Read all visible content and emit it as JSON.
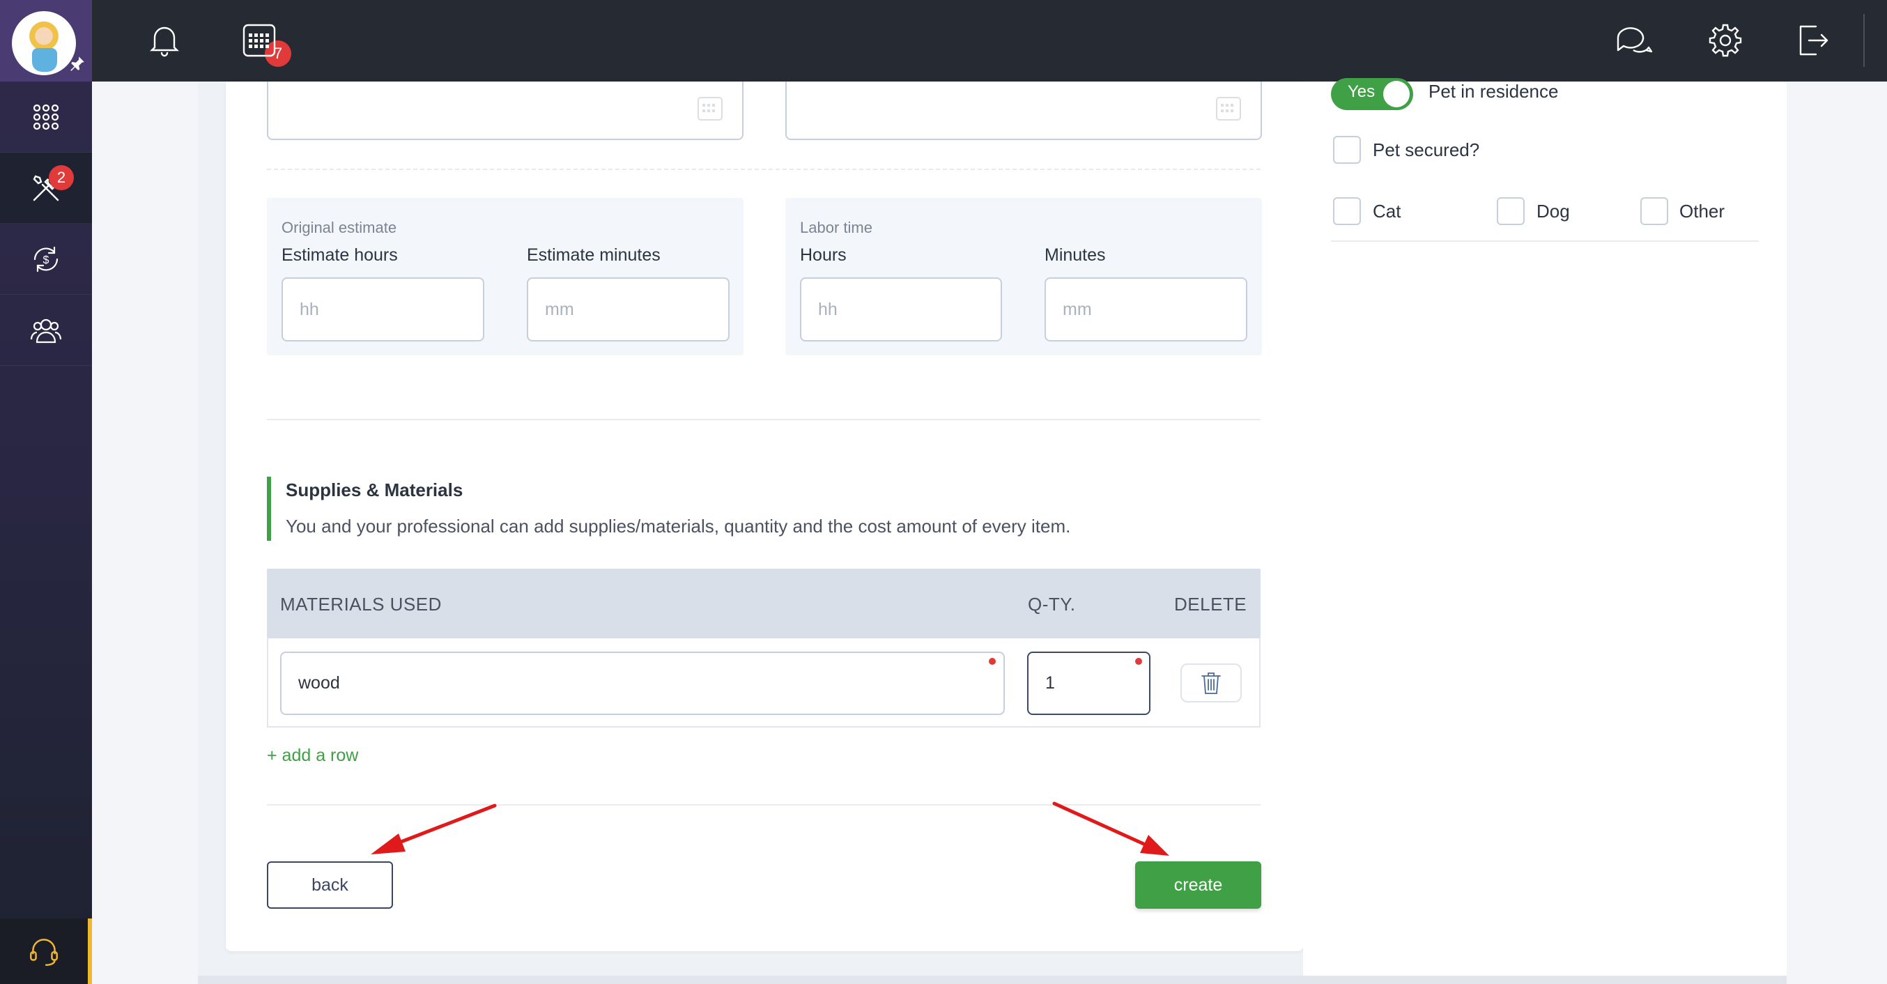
{
  "topbar": {
    "notification_count": "7"
  },
  "sidebar": {
    "tools_badge": "2"
  },
  "time": {
    "original_estimate": {
      "caption": "Original estimate",
      "hours_label": "Estimate hours",
      "hours_placeholder": "hh",
      "minutes_label": "Estimate minutes",
      "minutes_placeholder": "mm"
    },
    "labor_time": {
      "caption": "Labor time",
      "hours_label": "Hours",
      "hours_placeholder": "hh",
      "minutes_label": "Minutes",
      "minutes_placeholder": "mm"
    }
  },
  "supplies": {
    "title": "Supplies & Materials",
    "description": "You and your professional can add supplies/materials, quantity and the cost amount of every item.",
    "columns": [
      "MATERIALS USED",
      "Q-TY.",
      "DELETE"
    ],
    "rows": [
      {
        "material": "wood",
        "quantity": "1"
      }
    ],
    "add_row_label": "+ add a row"
  },
  "actions": {
    "back_label": "back",
    "create_label": "create"
  },
  "pets": {
    "toggle_value": "Yes",
    "pet_in_residence_label": "Pet in residence",
    "pet_secured_label": "Pet secured?",
    "types": [
      "Cat",
      "Dog",
      "Other"
    ]
  },
  "colors": {
    "accent_green": "#3fa046",
    "badge_red": "#e03a3a",
    "topbar_bg": "#262a33",
    "sidebar_bg": "#2f2a4a"
  },
  "icons": [
    "bell-icon",
    "calendar-icon",
    "chat-icon",
    "gear-icon",
    "logout-icon",
    "apps-grid-icon",
    "tools-icon",
    "billing-cycle-icon",
    "team-icon",
    "headset-icon",
    "trash-icon",
    "pin-icon"
  ]
}
